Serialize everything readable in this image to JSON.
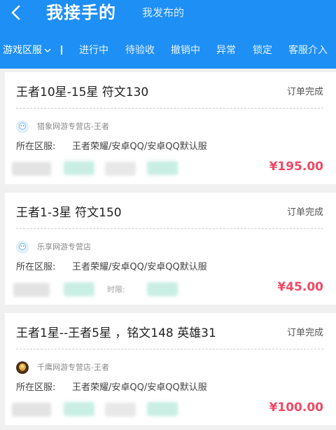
{
  "header": {
    "title_active": "我接手的",
    "title_inactive": "我发布的"
  },
  "filters": {
    "region": "游戏区服",
    "divider": "I",
    "tabs": [
      "进行中",
      "待验收",
      "撤销中",
      "异常",
      "锁定",
      "客服介入"
    ]
  },
  "orders": [
    {
      "title": "王者10星-15星   符文130",
      "status": "订单完成",
      "shop": "猎象网游专营店-王者",
      "region_label": "所在区服:",
      "region_value": "王者荣耀/安卓QQ/安卓QQ默认服",
      "price": "¥195.00"
    },
    {
      "title": "王者1-3星 符文150",
      "status": "订单完成",
      "shop": "乐享网游专营店",
      "region_label": "所在区服:",
      "region_value": "王者荣耀/安卓QQ/安卓QQ默认服",
      "blur_text": "时限:",
      "price": "¥45.00"
    },
    {
      "title": "王者1星--王者5星  ，铭文148 英雄31",
      "status": "订单完成",
      "shop": "千鹰网游专营店-王者",
      "region_label": "所在区服:",
      "region_value": "王者荣耀/安卓QQ/安卓QQ默认服",
      "price": "¥100.00"
    }
  ],
  "colors": {
    "header": "#1e8ff5",
    "price": "#f04864",
    "background": "#f0f0f0"
  },
  "icons": [
    "back-arrow-icon",
    "chevron-down-icon",
    "shop-avatar-icon"
  ]
}
